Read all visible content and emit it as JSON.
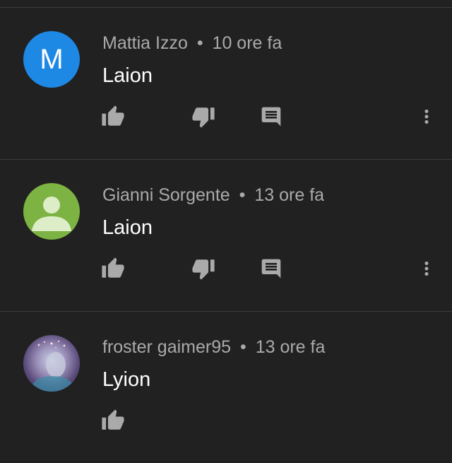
{
  "comments": [
    {
      "author": "Mattia Izzo",
      "separator": "•",
      "time": "10 ore fa",
      "text": "Laion",
      "avatar": {
        "type": "letter",
        "letter": "M",
        "color": "#1e88e5"
      },
      "actions": [
        "thumb-up-icon",
        "thumb-down-icon",
        "reply-icon",
        "more-vert-icon"
      ]
    },
    {
      "author": "Gianni Sorgente",
      "separator": "•",
      "time": "13 ore fa",
      "text": "Laion",
      "avatar": {
        "type": "default-person",
        "color": "#7cb342"
      },
      "actions": [
        "thumb-up-icon",
        "thumb-down-icon",
        "reply-icon",
        "more-vert-icon"
      ]
    },
    {
      "author": "froster gaimer95",
      "separator": "•",
      "time": "13 ore fa",
      "text": "Lyion",
      "avatar": {
        "type": "photo"
      },
      "actions": [
        "thumb-up-icon"
      ]
    }
  ],
  "colors": {
    "background": "#212121",
    "secondary_text": "#aaaaaa",
    "divider": "#3b3b3b"
  }
}
